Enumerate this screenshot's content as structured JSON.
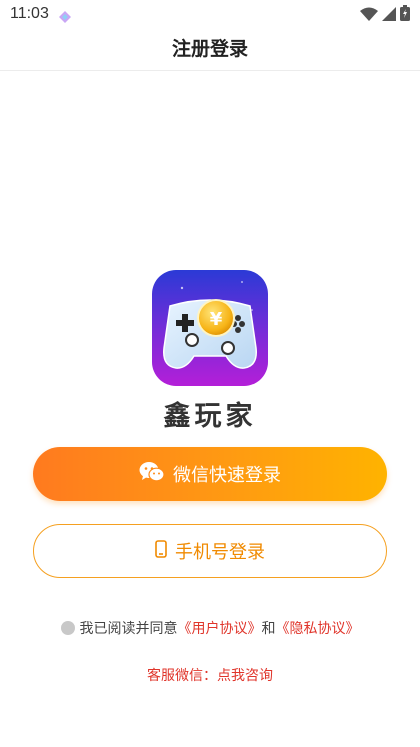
{
  "status_bar": {
    "time": "11:03"
  },
  "nav": {
    "title": "注册登录"
  },
  "app": {
    "name": "鑫玩家"
  },
  "buttons": {
    "wechat_label": "微信快速登录",
    "phone_label": "手机号登录"
  },
  "agreement": {
    "prefix": "我已阅读并同意",
    "user_agreement": "《用户协议》",
    "and": "和",
    "privacy_policy": "《隐私协议》"
  },
  "service": {
    "label": "客服微信：",
    "link": "点我咨询"
  },
  "colors": {
    "accent_orange": "#ff9a12",
    "link_red": "#e0352b"
  }
}
